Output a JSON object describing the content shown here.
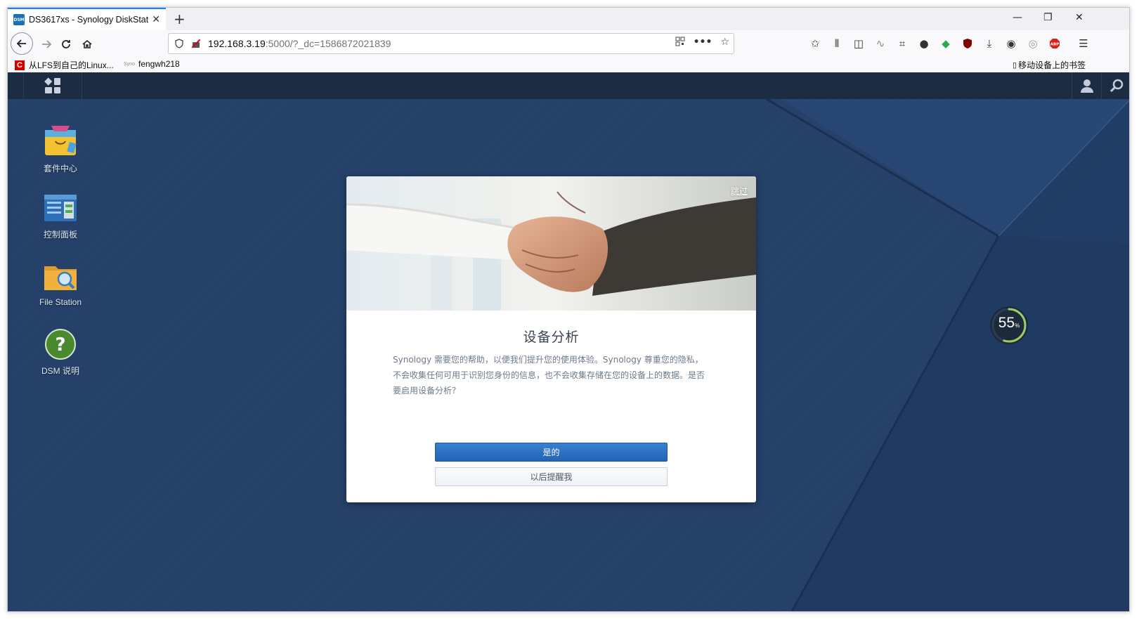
{
  "browser": {
    "tab_title": "DS3617xs - Synology DiskStation",
    "favicon_text": "DSM",
    "new_tab": "+",
    "close_tab": "✕",
    "minimize": "—",
    "restore": "❐",
    "close_window": "✕",
    "url_host": "192.168.3.19",
    "url_rest": ":5000/?_dc=1586872021839",
    "bookmarks": [
      {
        "label": "从LFS到自己的Linux...",
        "icon": "red-c-icon"
      },
      {
        "label": "fengwh218",
        "icon": "synology-icon"
      }
    ],
    "mobile_bookmarks": "移动设备上的书签"
  },
  "desktop": {
    "icons": [
      {
        "label": "套件中心",
        "icon": "package-center-icon"
      },
      {
        "label": "控制面板",
        "icon": "control-panel-icon"
      },
      {
        "label": "File Station",
        "icon": "file-station-icon"
      },
      {
        "label": "DSM 说明",
        "icon": "help-icon"
      }
    ]
  },
  "dialog": {
    "skip": "跳过",
    "title": "设备分析",
    "body": "Synology 需要您的帮助，以便我们提升您的使用体验。Synology 尊重您的隐私，不会收集任何可用于识别您身份的信息，也不会收集存储在您的设备上的数据。是否要启用设备分析？",
    "yes_button": "是的",
    "later_button": "以后提醒我"
  },
  "gauge": {
    "value": "55",
    "unit": "%",
    "fraction": 0.55,
    "color": "#9ccc65"
  },
  "colors": {
    "desktop_bg": "#26426b",
    "taskbar": "#1b2c43",
    "primary_button": "#2a6cbf"
  }
}
